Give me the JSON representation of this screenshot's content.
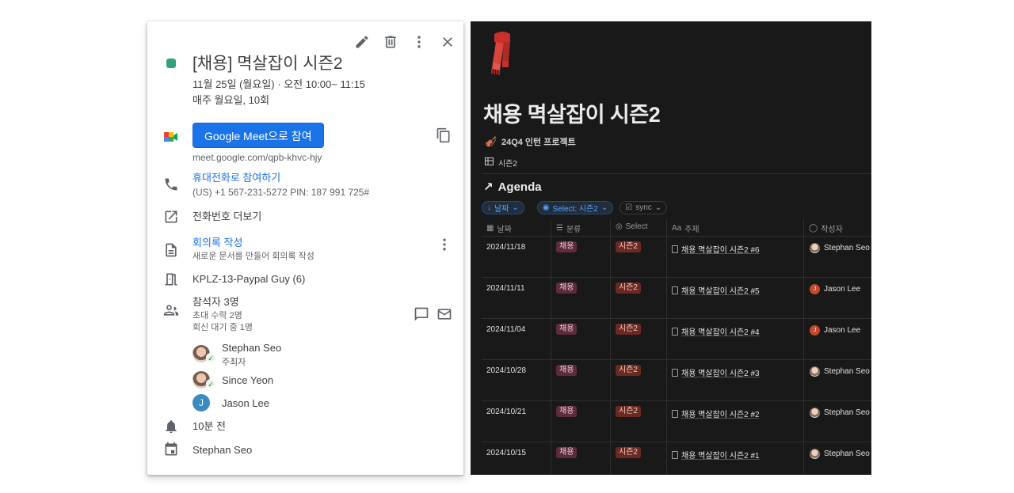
{
  "gcal": {
    "title": "[채용] 멱살잡이 시즌2",
    "date_line": "11월 25일 (월요일)  ·  오전 10:00~ 11:15",
    "recurrence": "매주 월요일, 10회",
    "meet_button": "Google Meet으로 참여",
    "meet_link": "meet.google.com/qpb-khvc-hjy",
    "phone_label": "휴대전화로 참여하기",
    "phone_detail": "(US) +1 567-231-5272 PIN: 187 991 725#",
    "more_phones": "전화번호 더보기",
    "notes_label": "회의록 작성",
    "notes_sub": "새로운 문서를 만들어 회의록 작성",
    "room": "KPLZ-13-Paypal Guy (6)",
    "guests_title": "참석자 3명",
    "guests_accepted": "초대 수락 2명",
    "guests_pending": "회신 대기 중 1명",
    "guests": [
      {
        "name": "Stephan Seo",
        "role": "주최자",
        "avatar_letter": ""
      },
      {
        "name": "Since Yeon",
        "role": "",
        "avatar_letter": ""
      },
      {
        "name": "Jason Lee",
        "role": "",
        "avatar_letter": "J"
      }
    ],
    "reminder": "10분 전",
    "calendar_owner": "Stephan Seo",
    "event_color": "#33a080"
  },
  "notion": {
    "page_title": "채용 멱살잡이 시즌2",
    "project_prop": "24Q4 인턴 프로젝트",
    "view_name": "시즌2",
    "section_title": "Agenda",
    "filters": [
      "날짜",
      "Select: 시즌2",
      "sync"
    ],
    "columns": [
      "날짜",
      "분류",
      "Select",
      "주제",
      "작성자"
    ],
    "column_icons": [
      "Aa"
    ],
    "rows": [
      {
        "date": "2024/11/18",
        "category": "채용",
        "select": "시즌2",
        "topic": "채용 멱살잡이 시즌2 #6",
        "author": "Stephan Seo",
        "author_letter": ""
      },
      {
        "date": "2024/11/11",
        "category": "채용",
        "select": "시즌2",
        "topic": "채용 멱살잡이 시즌2 #5",
        "author": "Jason Lee",
        "author_letter": "J"
      },
      {
        "date": "2024/11/04",
        "category": "채용",
        "select": "시즌2",
        "topic": "채용 멱살잡이 시즌2 #4",
        "author": "Jason Lee",
        "author_letter": "J"
      },
      {
        "date": "2024/10/28",
        "category": "채용",
        "select": "시즌2",
        "topic": "채용 멱살잡이 시즌2 #3",
        "author": "Stephan Seo",
        "author_letter": ""
      },
      {
        "date": "2024/10/21",
        "category": "채용",
        "select": "시즌2",
        "topic": "채용 멱살잡이 시즌2 #2",
        "author": "Stephan Seo",
        "author_letter": ""
      },
      {
        "date": "2024/10/15",
        "category": "채용",
        "select": "시즌2",
        "topic": "채용 멱살잡이 시즌2 #1",
        "author": "Stephan Seo",
        "author_letter": ""
      }
    ],
    "colors": {
      "background": "#191919",
      "tag_category": "#5c2b3c",
      "tag_select": "#6a2a23",
      "filter_accent": "#5aa1f7"
    }
  }
}
